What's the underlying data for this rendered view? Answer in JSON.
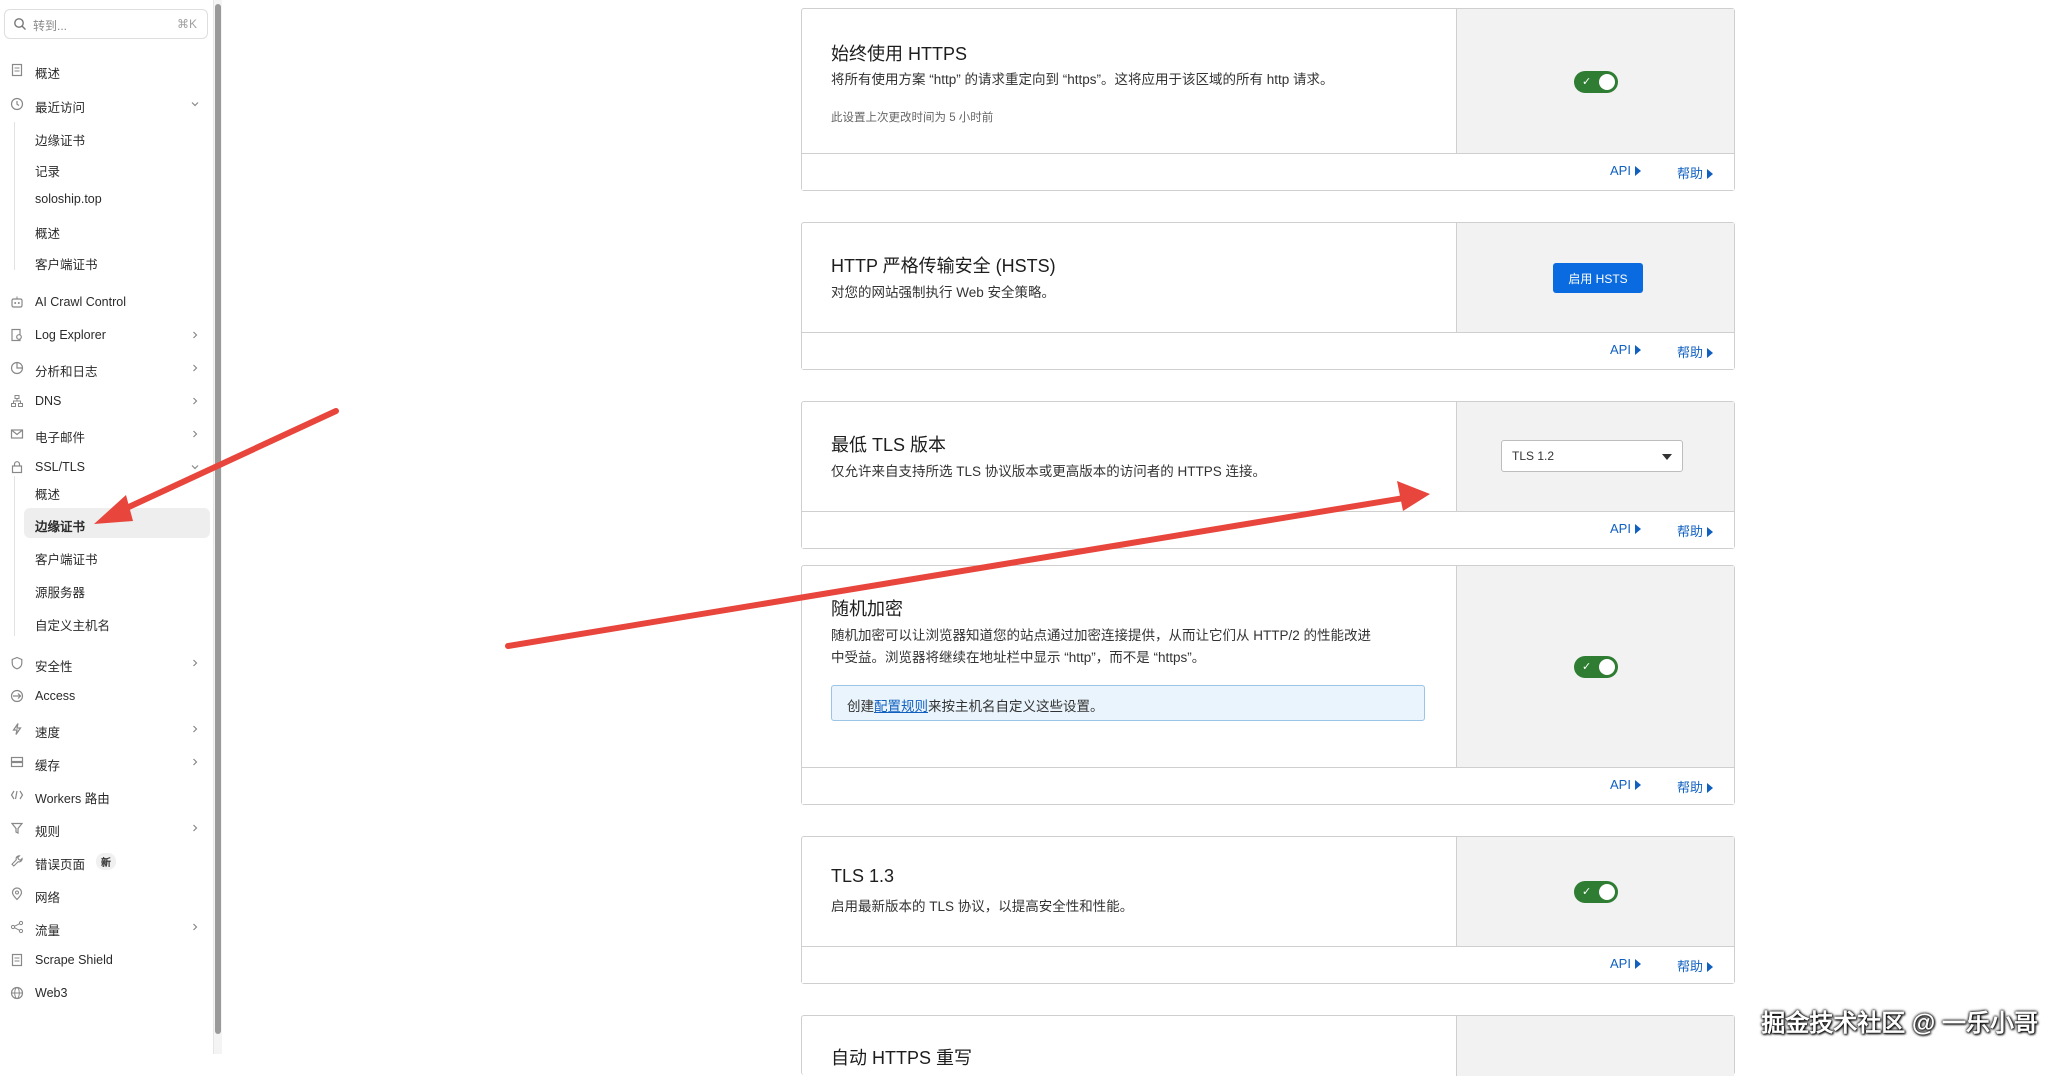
{
  "sidebar": {
    "search_placeholder": "转到...",
    "search_shortcut": "⌘K",
    "items": [
      {
        "label": "概述",
        "icon": "document-icon"
      },
      {
        "label": "最近访问",
        "icon": "clock-icon"
      },
      {
        "label": "边缘证书"
      },
      {
        "label": "记录"
      },
      {
        "label": "soloship.top"
      },
      {
        "label": "概述"
      },
      {
        "label": "客户端证书"
      },
      {
        "label": "AI Crawl Control",
        "icon": "robot-icon"
      },
      {
        "label": "Log Explorer",
        "icon": "file-search-icon"
      },
      {
        "label": "分析和日志",
        "icon": "chart-pie-icon"
      },
      {
        "label": "DNS",
        "icon": "network-icon"
      },
      {
        "label": "电子邮件",
        "icon": "mail-icon"
      },
      {
        "label": "SSL/TLS",
        "icon": "lock-icon"
      },
      {
        "label": "概述"
      },
      {
        "label": "边缘证书"
      },
      {
        "label": "客户端证书"
      },
      {
        "label": "源服务器"
      },
      {
        "label": "自定义主机名"
      },
      {
        "label": "安全性",
        "icon": "shield-icon"
      },
      {
        "label": "Access",
        "icon": "access-icon"
      },
      {
        "label": "速度",
        "icon": "bolt-icon"
      },
      {
        "label": "缓存",
        "icon": "storage-icon"
      },
      {
        "label": "Workers 路由",
        "icon": "workers-icon"
      },
      {
        "label": "规则",
        "icon": "funnel-icon"
      },
      {
        "label": "错误页面",
        "icon": "wrench-icon",
        "badge": "新"
      },
      {
        "label": "网络",
        "icon": "pin-icon"
      },
      {
        "label": "流量",
        "icon": "share-icon"
      },
      {
        "label": "Scrape Shield",
        "icon": "shield-doc-icon"
      },
      {
        "label": "Web3",
        "icon": "globe-icon"
      }
    ]
  },
  "cards": {
    "https": {
      "title": "始终使用 HTTPS",
      "description": "将所有使用方案 “http” 的请求重定向到 “https”。这将应用于该区域的所有 http 请求。",
      "meta": "此设置上次更改时间为 5 小时前",
      "enabled": true
    },
    "hsts": {
      "title": "HTTP 严格传输安全 (HSTS)",
      "description": "对您的网站强制执行 Web 安全策略。",
      "button": "启用 HSTS"
    },
    "tls_min": {
      "title": "最低 TLS 版本",
      "description": "仅允许来自支持所选 TLS 协议版本或更高版本的访问者的 HTTPS 连接。",
      "selected": "TLS 1.2"
    },
    "random": {
      "title": "随机加密",
      "description_line1": "随机加密可以让浏览器知道您的站点通过加密连接提供，从而让它们从 HTTP/2 的性能改进",
      "description_line2": "中受益。浏览器将继续在地址栏中显示 “http”，而不是 “https”。",
      "info_prefix": "创建",
      "info_link": "配置规则",
      "info_suffix": "来按主机名自定义这些设置。",
      "enabled": true
    },
    "tls13": {
      "title": "TLS 1.3",
      "description": "启用最新版本的 TLS 协议，以提高安全性和性能。",
      "enabled": true
    },
    "auto_rewrite": {
      "title": "自动 HTTPS 重写"
    }
  },
  "footer_links": {
    "api": "API",
    "help": "帮助"
  },
  "watermark": "掘金技术社区 @ 一乐小哥",
  "colors": {
    "accent": "#0a6be0",
    "toggle_on": "#2e7d32",
    "arrow": "#e8453c",
    "link": "#1060c0"
  }
}
